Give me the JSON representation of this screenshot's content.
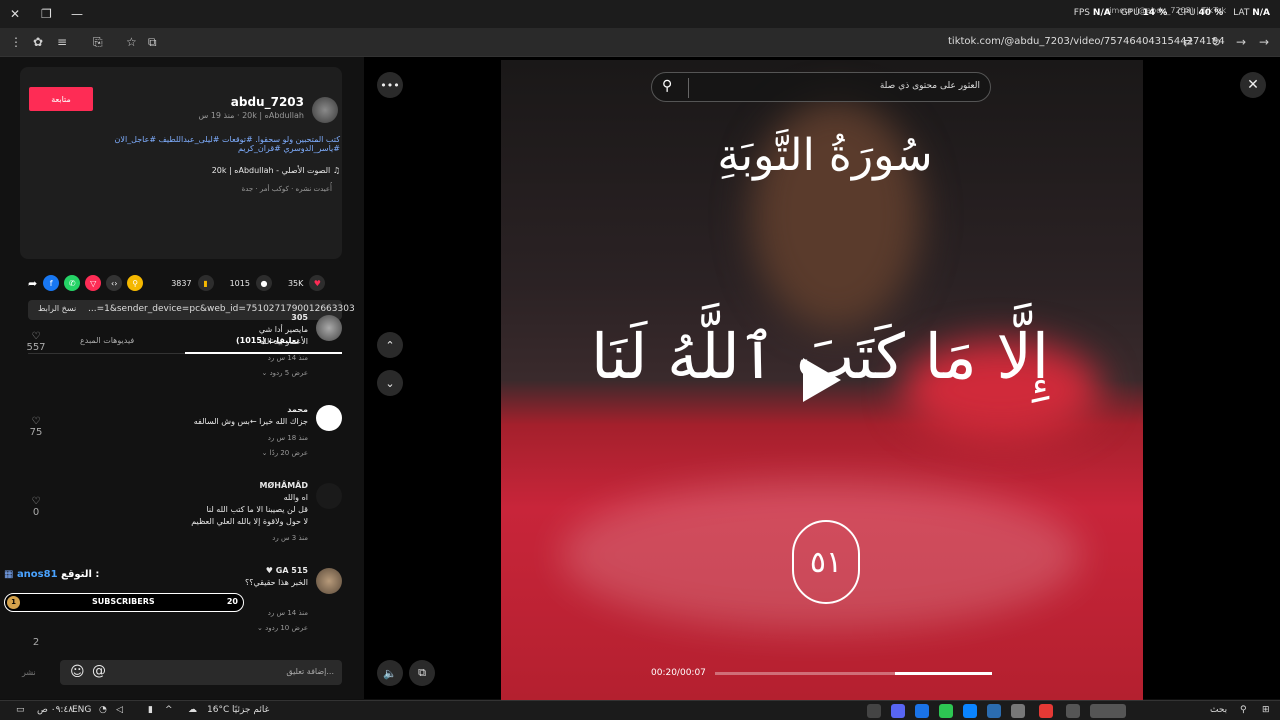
{
  "browser": {
    "stats": {
      "fps_label": "FPS",
      "fps": "N/A",
      "gpu_label": "GPU",
      "gpu": "14 %",
      "cpu_label": "CPU",
      "cpu": "40 %",
      "lat_label": "LAT",
      "lat": "N/A"
    },
    "notification": "rimeur (@abdu_7203) | TikTok",
    "url": "tiktok.com/@abdu_7203/video/7574640431544274194"
  },
  "post": {
    "username": "abdu_7203",
    "meta": "Abdullahه | 20k · منذ 19 س",
    "follow_label": "متابعة",
    "caption_line1": "كتب المتحبين ولو سحقوا. #توقعات #ليلى_عبداللطيف #عاجل_الان",
    "caption_line2": "#ياسر_الدوسري #قران_كريم",
    "sound": "الصوت الأصلي - Abdullahه | 20k",
    "sub_meta_1": "أُعيدت نشره",
    "sub_meta_2": "كوكب أمر · جدة",
    "likes": "35K",
    "comments": "1015",
    "saves": "3837",
    "link_text": "...=1&sender_device=pc&web_id=7510271790012663303",
    "copy_link_label": "نسخ الرابط",
    "tab_comments": "تعليقات (1015)",
    "tab_creator_videos": "فيديوهات المبدع"
  },
  "comments": [
    {
      "name": "305",
      "text": [
        "مايصير أدا شي",
        "الأعمار بيد الله"
      ],
      "time": "منذ 14 س",
      "reply": "رد",
      "replies": "عرض 5 ردود",
      "likes": "557"
    },
    {
      "name": "محمد",
      "text": [
        "جزاك الله خيرا ←بس وش السالفه"
      ],
      "time": "منذ 18 س",
      "reply": "رد",
      "replies": "عرض 20 ردًا",
      "likes": "75"
    },
    {
      "name": "MØHÂMÂD",
      "text": [
        "اه والله",
        "قل لن يصيبنا الا ما كتب الله لنا",
        "لا حول ولاقوة إلا بالله العلي العظيم"
      ],
      "time": "منذ 3 س",
      "reply": "رد",
      "replies": "",
      "likes": "0"
    },
    {
      "name": "GA 515 ♥",
      "text": [
        "الخبر هذا حقيقي؟؟"
      ],
      "time": "منذ 14 س",
      "reply": "رد",
      "replies": "عرض 10 ردود",
      "likes": "2"
    }
  ],
  "overlay": {
    "predict_label": "التوقع :",
    "predict_user": "anos81",
    "sub_left": "1",
    "sub_text": "SUBSCRIBERS",
    "sub_right": "20"
  },
  "comment_input": {
    "placeholder": "إضافة تعليق...",
    "post_label": "نشر"
  },
  "video": {
    "search_placeholder": "العثور على محتوى ذي صلة",
    "title_verse": "سُورَةُ التَّوبَةِ",
    "verse": "إِلَّا مَا كَتَبَ ٱللَّهُ لَنَا",
    "number": "٥١",
    "time": "00:20/00:07",
    "progress": 0.65
  },
  "taskbar": {
    "time": "٠٩:٤٨ ص",
    "lang": "ENG",
    "weather": "16°C",
    "weather_label": "غائم جزئيًا",
    "search": "بحث"
  }
}
